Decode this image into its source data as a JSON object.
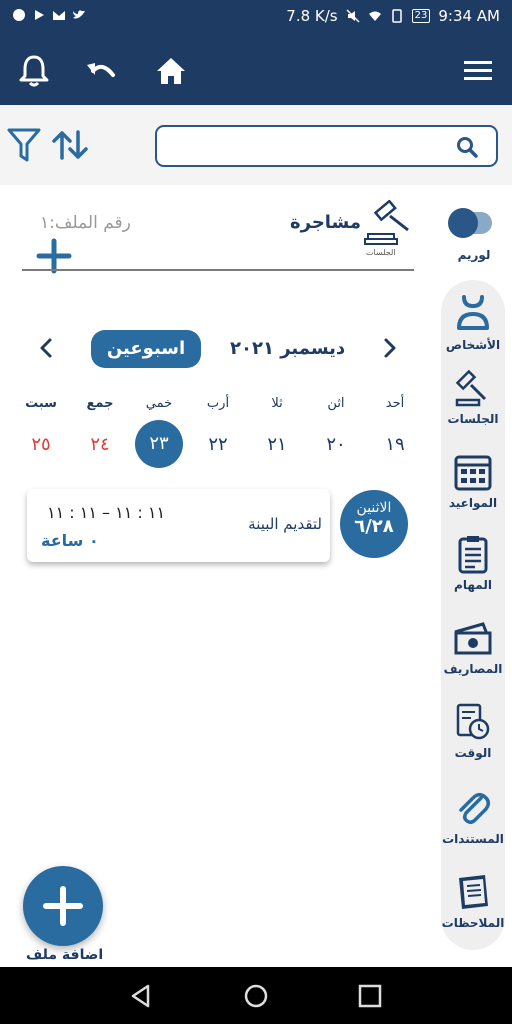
{
  "status_bar": {
    "speed": "7.8 K/s",
    "battery": "23",
    "time": "9:34 AM"
  },
  "app_bar": {
    "icons": [
      "bell-icon",
      "undo-icon",
      "home-icon",
      "menu-icon"
    ]
  },
  "search": {
    "placeholder": "",
    "value": ""
  },
  "toggle": {
    "label": "لوريم",
    "on": true
  },
  "sidebar": {
    "items": [
      {
        "label": "الأشخاص",
        "icon": "person-icon"
      },
      {
        "label": "الجلسات",
        "icon": "gavel-icon"
      },
      {
        "label": "المواعيد",
        "icon": "calendar-icon"
      },
      {
        "label": "المهام",
        "icon": "clipboard-icon"
      },
      {
        "label": "المصاريف",
        "icon": "money-icon"
      },
      {
        "label": "الوقت",
        "icon": "timesheet-icon"
      },
      {
        "label": "المستندات",
        "icon": "paperclip-icon"
      },
      {
        "label": "الملاحظات",
        "icon": "notes-icon"
      }
    ]
  },
  "case": {
    "title": "مشاجرة",
    "icon_label": "الجلسات",
    "file_number": "رقم الملف:١"
  },
  "calendar": {
    "month": "ديسمبر ٢٠٢١",
    "week_button": "اسبوعين",
    "days": [
      {
        "name": "أحد",
        "num": "١٩"
      },
      {
        "name": "اثن",
        "num": "٢٠"
      },
      {
        "name": "ثلا",
        "num": "٢١"
      },
      {
        "name": "أرب",
        "num": "٢٢"
      },
      {
        "name": "خمي",
        "num": "٢٣"
      },
      {
        "name": "جمع",
        "num": "٢٤"
      },
      {
        "name": "سبت",
        "num": "٢٥"
      }
    ],
    "selected_index": 4
  },
  "event": {
    "day": "الاثنين",
    "date": "٦/٢٨",
    "time": "١١ : ١١ – ١١ : ١١",
    "title": "لتقديم البينة",
    "duration": "٠ ساعة"
  },
  "fab": {
    "label": "اضافة ملف"
  },
  "colors": {
    "primary": "#1e3b64",
    "accent": "#2a6ba0",
    "weekend": "#d9423b"
  }
}
